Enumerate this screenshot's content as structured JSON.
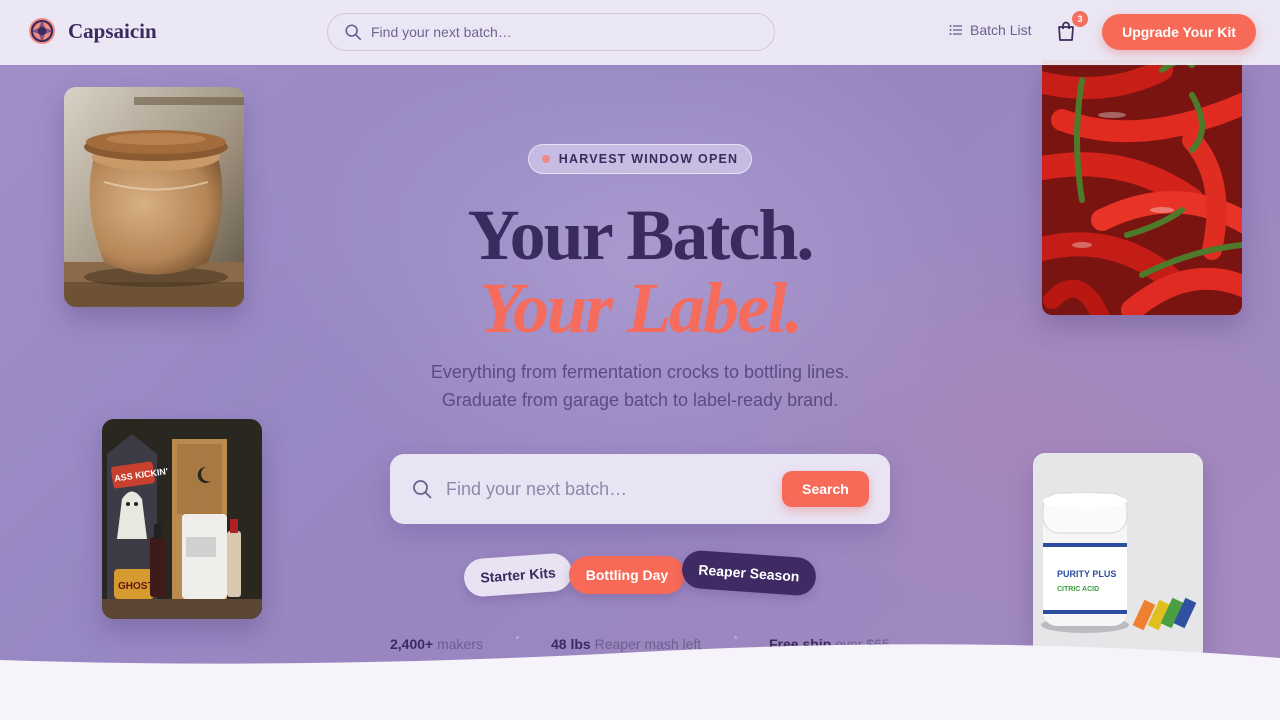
{
  "header": {
    "brand_name": "Capsaicin",
    "search_placeholder": "Find your next batch…",
    "batch_list_label": "Batch List",
    "cart_count": "3",
    "upgrade_label": "Upgrade Your Kit"
  },
  "hero": {
    "badge": "HARVEST WINDOW OPEN",
    "headline_line1": "Your Batch.",
    "headline_line2": "Your Label.",
    "subtitle_line1": "Everything from fermentation crocks to bottling lines.",
    "subtitle_line2": "Graduate from garage batch to label-ready brand.",
    "search_placeholder": "Find your next batch…",
    "search_button": "Search",
    "tags": [
      "Starter Kits",
      "Bottling Day",
      "Reaper Season"
    ],
    "stats": [
      {
        "value": "2,400+",
        "label": "makers"
      },
      {
        "value": "48 lbs",
        "label": "Reaper mash left"
      },
      {
        "value": "Free ship",
        "label": "over $65"
      }
    ]
  },
  "photos": {
    "jar_brand": "PURITY PLUS",
    "jar_label": "CITRIC ACID",
    "sauce_label": "ASS KICKIN'",
    "sauce_bottle": "GHOST"
  },
  "colors": {
    "accent": "#f76a58",
    "ink": "#3a2b5e",
    "background": "#9a88c3",
    "dark_tag": "#3f2a63"
  },
  "icons": [
    "logo-icon",
    "search-icon",
    "list-icon",
    "shopping-bag-icon"
  ]
}
